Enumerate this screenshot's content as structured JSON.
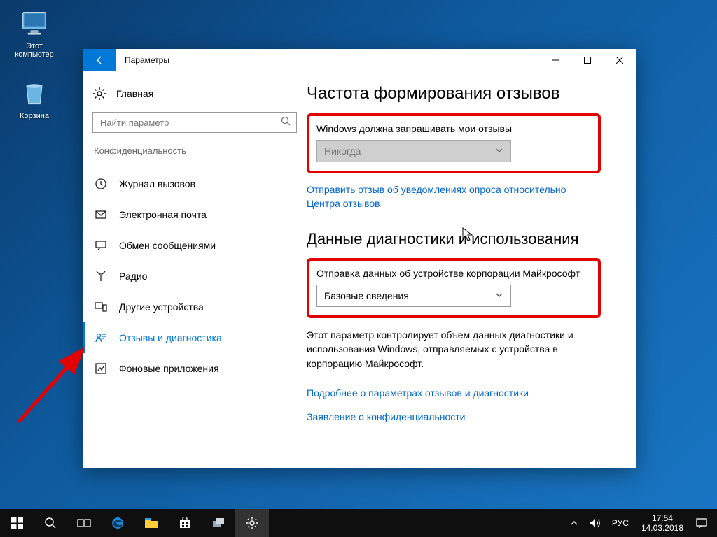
{
  "desktop": {
    "this_pc": "Этот компьютер",
    "recycle_bin": "Корзина"
  },
  "window": {
    "title": "Параметры",
    "home": "Главная",
    "search_placeholder": "Найти параметр",
    "group": "Конфиденциальность",
    "nav": {
      "call_history": "Журнал вызовов",
      "email": "Электронная почта",
      "messaging": "Обмен сообщениями",
      "radio": "Радио",
      "other_devices": "Другие устройства",
      "feedback": "Отзывы и диагностика",
      "background_apps": "Фоновые приложения"
    },
    "content": {
      "h1": "Частота формирования отзывов",
      "feedback_label": "Windows должна запрашивать мои отзывы",
      "feedback_value": "Никогда",
      "send_feedback_link": "Отправить отзыв об уведомлениях опроса относительно Центра отзывов",
      "h2": "Данные диагностики и использования",
      "diag_label": "Отправка данных об устройстве корпорации Майкрософт",
      "diag_value": "Базовые сведения",
      "desc": "Этот параметр контролирует объем данных диагностики и использования Windows, отправляемых с устройства в корпорацию Майкрософт.",
      "more_link": "Подробнее о параметрах отзывов и диагностики",
      "privacy_link": "Заявление о конфиденциальности"
    }
  },
  "taskbar": {
    "lang": "РУС",
    "time": "17:54",
    "date": "14.03.2018"
  }
}
